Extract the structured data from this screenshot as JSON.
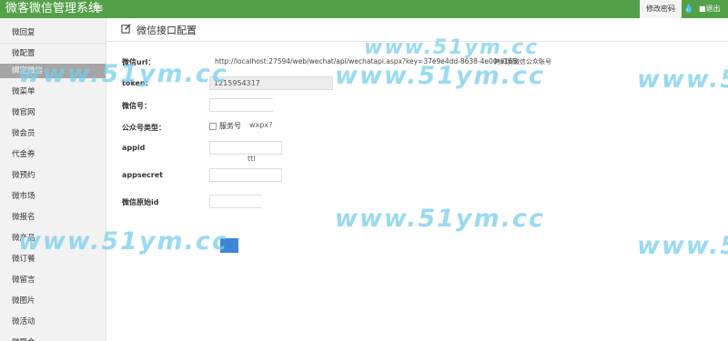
{
  "header": {
    "brand": "微客微信管理系统",
    "menu_icon": "≡",
    "change_password": "修改密码",
    "drop_icon": "💧",
    "logout": "■退出"
  },
  "sidebar": {
    "items": [
      {
        "label": "微回复",
        "active": false
      },
      {
        "label": "微配置",
        "active": false
      },
      {
        "label": "绑定微信",
        "active": true
      },
      {
        "label": "微菜单",
        "active": false
      },
      {
        "label": "微官网",
        "active": false
      },
      {
        "label": "微会员",
        "active": false
      },
      {
        "label": "代金券",
        "active": false
      },
      {
        "label": "微预约",
        "active": false
      },
      {
        "label": "微市场",
        "active": false
      },
      {
        "label": "微报名",
        "active": false
      },
      {
        "label": "微产品",
        "active": false
      },
      {
        "label": "微订餐",
        "active": false
      },
      {
        "label": "微留言",
        "active": false
      },
      {
        "label": "微图片",
        "active": false
      },
      {
        "label": "微活动",
        "active": false
      },
      {
        "label": "微聚会",
        "active": false
      }
    ]
  },
  "main": {
    "title": "微信接口配置",
    "form": {
      "url_label": "微信url：",
      "url_value": "http://localhost:27594/web/wechat/api/wechatapi.aspx?key=37e9e4dd-8638-4e00-a165",
      "copy_hint": "拷贝到微信公众账号",
      "token_label": "token：",
      "token_value": "1215954317",
      "wechat_id_label": "微信号：",
      "wechat_id_value": "",
      "account_type_label": "公众号类型：",
      "account_type_option": "服务号",
      "account_type_residue": "wxpx?ke",
      "appid_label": "appid",
      "appid_value": "",
      "appsecret_label": "appsecret",
      "appsecret_value": "",
      "appsecret_residue": "ttl",
      "origin_id_label": "微信原始id",
      "origin_id_value": "",
      "submit_label": "保"
    }
  },
  "watermark": "www.51ym.cc",
  "colors": {
    "header_bg": "#52a048",
    "watermark": "#78cdeb",
    "submit_bg": "#3d86d8"
  }
}
